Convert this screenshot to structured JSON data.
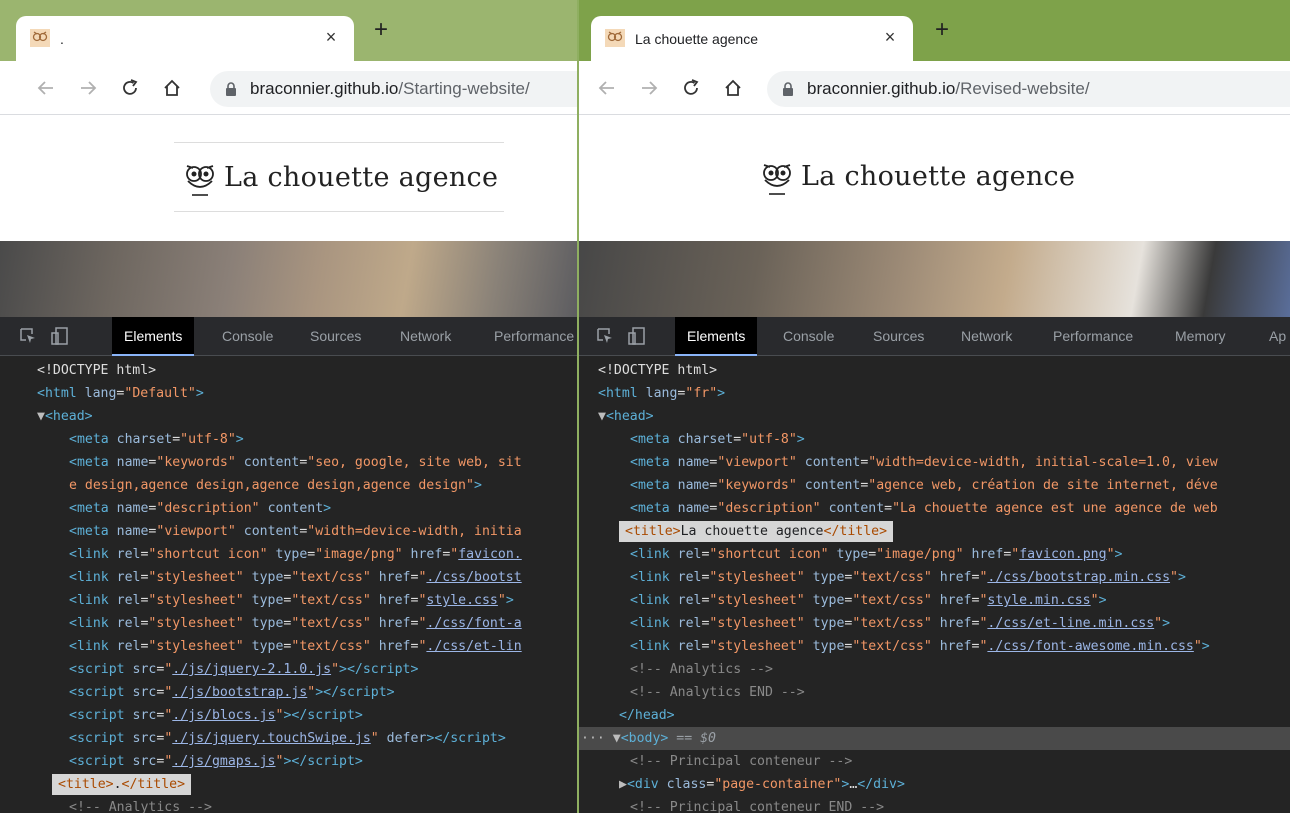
{
  "left": {
    "tab": {
      "title": ".",
      "close": "×"
    },
    "new_tab": "+",
    "url": {
      "host": "braconnier.github.io",
      "path": "/Starting-website/"
    },
    "brand": "La chouette agence",
    "devtools": {
      "tabs": [
        "Elements",
        "Console",
        "Sources",
        "Network",
        "Performance"
      ],
      "doctype": "<!DOCTYPE html>",
      "html_lang": "Default",
      "meta_charset": "utf-8",
      "meta_keywords_name": "keywords",
      "meta_keywords_content_l1": "seo, google, site web, sit",
      "meta_keywords_content_l2": "e design,agence design,agence design,agence design",
      "meta_description_name": "description",
      "meta_viewport_name": "viewport",
      "meta_viewport_content": "width=device-width, initia",
      "link_icon_rel": "shortcut icon",
      "link_icon_type": "image/png",
      "link_icon_href": "favicon.",
      "css_bootstrap": "./css/bootst",
      "css_style": "style.css",
      "css_font": "./css/font-a",
      "css_etline": "./css/et-lin",
      "js_jquery": "./js/jquery-2.1.0.js",
      "js_bootstrap": "./js/bootstrap.js",
      "js_blocs": "./js/blocs.js",
      "js_touchswipe": "./js/jquery.touchSwipe.js",
      "js_gmaps": "./js/gmaps.js",
      "title_text": ".",
      "comment_analytics": "<!-- Analytics -->"
    }
  },
  "right": {
    "tab": {
      "title": "La chouette agence",
      "close": "×"
    },
    "new_tab": "+",
    "url": {
      "host": "braconnier.github.io",
      "path": "/Revised-website/"
    },
    "brand": "La chouette agence",
    "devtools": {
      "tabs": [
        "Elements",
        "Console",
        "Sources",
        "Network",
        "Performance",
        "Memory",
        "Ap"
      ],
      "doctype": "<!DOCTYPE html>",
      "html_lang": "fr",
      "meta_charset": "utf-8",
      "meta_viewport_name": "viewport",
      "meta_viewport_content": "width=device-width, initial-scale=1.0, view",
      "meta_keywords_name": "keywords",
      "meta_keywords_content": "agence web, création de site internet, déve",
      "meta_description_name": "description",
      "meta_description_content": "La chouette agence est une agence de web",
      "title_text": "La chouette agence",
      "link_icon_rel": "shortcut icon",
      "link_icon_type": "image/png",
      "link_icon_href": "favicon.png",
      "css_bootstrap": "./css/bootstrap.min.css",
      "css_style": "style.min.css",
      "css_etline": "./css/et-line.min.css",
      "css_font": "./css/font-awesome.min.css",
      "comment_analytics": "<!-- Analytics -->",
      "comment_analytics_end": "<!-- Analytics END -->",
      "body_selected_marker": "== $0",
      "comment_container": "<!-- Principal conteneur -->",
      "div_class": "page-container",
      "comment_container_end": "<!-- Principal conteneur END -->"
    }
  }
}
